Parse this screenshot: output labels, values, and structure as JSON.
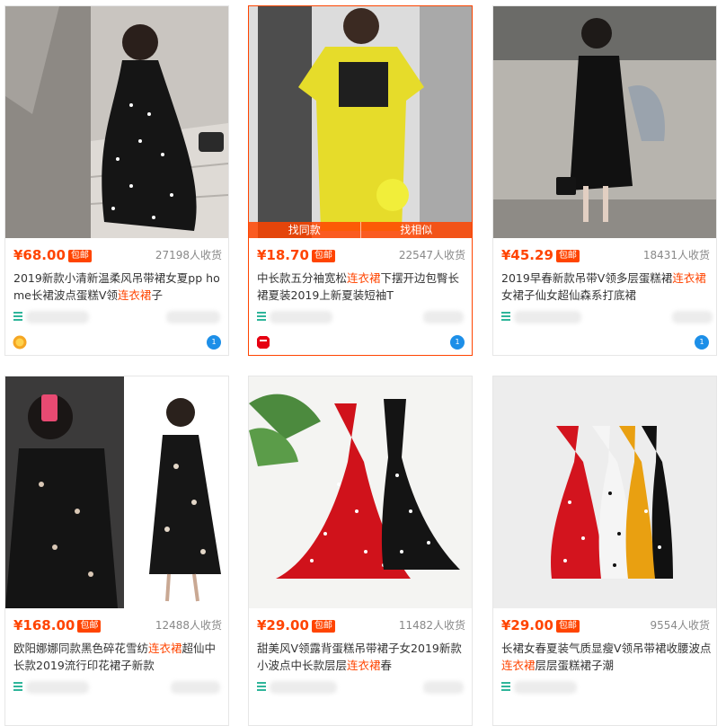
{
  "colors": {
    "accent": "#ff4400",
    "shop_icon": "#2fb59a",
    "wangwang": "#1d8fe8"
  },
  "free_shipping_label": "包邮",
  "hover_actions": [
    "找同款",
    "找相似"
  ],
  "products": [
    {
      "price": "¥68.00",
      "sales": "27198人收货",
      "title_before": "2019新款小清新温柔风吊带裙女夏pp home长裙波点蛋糕V领",
      "title_highlight": "连衣裙",
      "title_after": "子",
      "badge_icon": "gold-medal-icon",
      "image": "black polka-dot strappy long dress"
    },
    {
      "price": "¥18.70",
      "sales": "22547人收货",
      "title_before": "中长款五分袖宽松",
      "title_highlight": "连衣裙",
      "title_after": "下摆开边包臀长裙夏装2019上新夏装短袖T",
      "badge_icon": "tmall-icon",
      "image": "yellow t-shirt dress"
    },
    {
      "price": "¥45.29",
      "sales": "18431人收货",
      "title_before": "2019早春新款吊带V领多层蛋糕裙",
      "title_highlight": "连衣裙",
      "title_after": "女裙子仙女超仙森系打底裙",
      "badge_icon": "blue-badge-icon",
      "image": "black tiered slip dress"
    },
    {
      "price": "¥168.00",
      "sales": "12488人收货",
      "title_before": "欧阳娜娜同款黑色碎花雪纺",
      "title_highlight": "连衣裙",
      "title_after": "超仙中长款2019流行印花裙子新款",
      "badge_icon": "gold-medal-icon",
      "image": "black floral chiffon long dress"
    },
    {
      "price": "¥29.00",
      "sales": "11482人收货",
      "title_before": "甜美风V领露背蛋糕吊带裙子女2019新款小波点中长款层层",
      "title_highlight": "连衣裙",
      "title_after": "春",
      "badge_icon": "gold-medal-icon",
      "image": "red and black polka-dot tiered dresses"
    },
    {
      "price": "¥29.00",
      "sales": "9554人收货",
      "title_before": "长裙女春夏装气质显瘦V领吊带裙收腰波点",
      "title_highlight": "连衣裙",
      "title_after": "层层蛋糕裙子潮",
      "badge_icon": "gold-medal-icon",
      "image": "four polka-dot tiered slip dresses"
    }
  ]
}
